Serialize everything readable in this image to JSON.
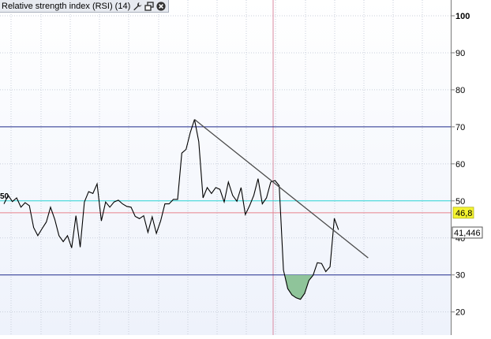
{
  "indicator": {
    "title": "Relative strength index (RSI) (14)",
    "left_level_label": "50",
    "current_value_badge": "46,8",
    "price_marker": "41,446"
  },
  "toolbar_icons": [
    "wrench-icon",
    "restore-window-icon",
    "close-icon"
  ],
  "colors": {
    "rsi_line": "#000000",
    "trendline": "#4a4a4a",
    "level_70_30": "#1f2a8c",
    "level_50": "#27d3d3",
    "level_current": "#e8828c",
    "cursor_vertical": "#d98aa0",
    "oversold_fill": "#8fc49a",
    "badge_bg": "#f4f430"
  },
  "chart_data": {
    "type": "line",
    "title": "Relative strength index (RSI) (14)",
    "ylim": [
      15,
      103
    ],
    "yticks": [
      20,
      30,
      40,
      50,
      60,
      70,
      80,
      90,
      100
    ],
    "grid": true,
    "reference_lines": [
      70,
      50,
      30
    ],
    "current_value": 46.8,
    "series": [
      {
        "values": [
          49.2,
          51.5,
          49.8,
          50.8,
          48.3,
          49.5,
          48.7,
          42.8,
          40.6,
          42.5,
          44.3,
          48.3,
          45.0,
          40.6,
          39.0,
          40.6,
          37.3,
          46.0,
          37.5,
          49.7,
          52.5,
          52.0,
          54.6,
          44.6,
          49.7,
          48.3,
          49.7,
          50.2,
          49.2,
          48.5,
          48.3,
          45.8,
          45.2,
          46.0,
          41.5,
          45.7,
          41.2,
          44.6,
          49.2,
          49.2,
          50.4,
          50.4,
          62.9,
          63.9,
          68.5,
          72.0,
          66.0,
          50.8,
          53.6,
          52.0,
          53.6,
          53.1,
          49.7,
          55.1,
          51.5,
          49.9,
          53.6,
          46.3,
          48.7,
          51.5,
          56.0,
          49.2,
          50.8,
          55.1,
          55.5,
          54.1,
          31.3,
          26.3,
          24.6,
          23.8,
          23.4,
          25.0,
          28.5,
          29.9,
          33.3,
          33.1,
          30.9,
          32.2,
          45.3,
          42.2
        ]
      }
    ],
    "trendline": {
      "from": {
        "index": 45,
        "value": 72.0
      },
      "to": {
        "index": 86,
        "value": 34.6
      }
    },
    "oversold_fill_threshold": 30
  }
}
